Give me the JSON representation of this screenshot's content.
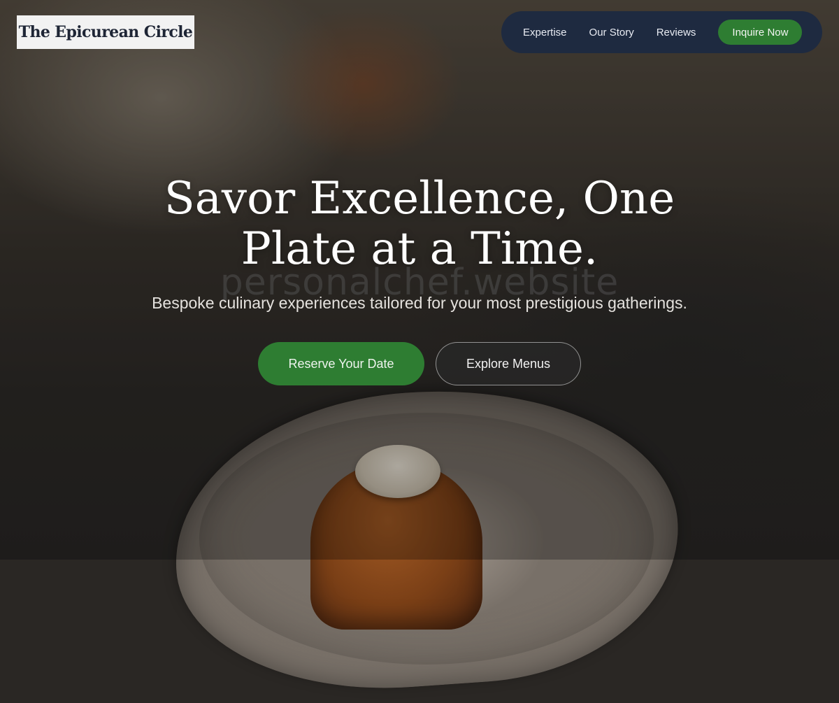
{
  "brand": {
    "logo_text": "The Epicurean Circle"
  },
  "nav": {
    "items": [
      {
        "label": "Expertise"
      },
      {
        "label": "Our Story"
      },
      {
        "label": "Reviews"
      }
    ],
    "cta_label": "Inquire Now"
  },
  "hero": {
    "title_line1": "Savor Excellence, One",
    "title_line2": "Plate at a Time.",
    "watermark": "personalchef.website",
    "subtitle": "Bespoke culinary experiences tailored for your most prestigious gatherings.",
    "primary_cta": "Reserve Your Date",
    "secondary_cta": "Explore Menus"
  },
  "colors": {
    "accent_green": "#2e7d32",
    "nav_background": "#1e2a40",
    "logo_background": "#f2f2f2",
    "logo_text": "#1e2535"
  }
}
